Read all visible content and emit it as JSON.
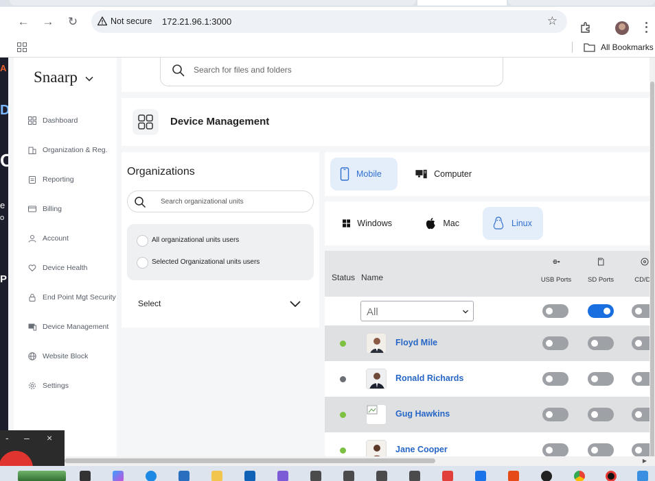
{
  "browser": {
    "security_label": "Not secure",
    "url": "172.21.96.1:3000",
    "bookmarks_label": "All Bookmarks"
  },
  "app": {
    "brand": "Snaarp",
    "search_placeholder": "Search for files and folders",
    "page_title": "Device Management"
  },
  "sidebar": {
    "items": [
      {
        "label": "Dashboard",
        "icon": "grid-icon"
      },
      {
        "label": "Organization & Reg.",
        "icon": "building-icon"
      },
      {
        "label": "Reporting",
        "icon": "clipboard-icon"
      },
      {
        "label": "Billing",
        "icon": "card-icon"
      },
      {
        "label": "Account",
        "icon": "user-icon"
      },
      {
        "label": "Device Health",
        "icon": "heart-icon"
      },
      {
        "label": "End Point Mgt Security",
        "icon": "lock-icon"
      },
      {
        "label": "Device Management",
        "icon": "device-icon"
      },
      {
        "label": "Website Block",
        "icon": "globe-icon"
      },
      {
        "label": "Settings",
        "icon": "gear-icon"
      }
    ]
  },
  "organizations": {
    "title": "Organizations",
    "search_placeholder": "Search organizational units",
    "options": [
      "All organizational units users",
      "Selected Organizational units users"
    ],
    "select_label": "Select"
  },
  "device_tabs": [
    "Mobile",
    "Computer"
  ],
  "os_tabs": [
    "Windows",
    "Mac",
    "Linux"
  ],
  "table": {
    "headers": {
      "status": "Status",
      "name": "Name",
      "usb": "USB Ports",
      "sd": "SD Ports",
      "cd": "CD/DV"
    },
    "filter_value": "All",
    "filter_toggles": {
      "usb": false,
      "sd": true,
      "cd": false
    },
    "rows": [
      {
        "name": "Floyd Mile",
        "status_color": "#7cc142"
      },
      {
        "name": "Ronald Richards",
        "status_color": "#6b6e73"
      },
      {
        "name": "Gug Hawkins",
        "status_color": "#7cc142"
      },
      {
        "name": "Jane Cooper",
        "status_color": "#7cc142"
      }
    ]
  },
  "colors": {
    "accent": "#2666c6",
    "toggle_on": "#1a6fe0",
    "online": "#7cc142",
    "offline": "#6b6e73"
  }
}
